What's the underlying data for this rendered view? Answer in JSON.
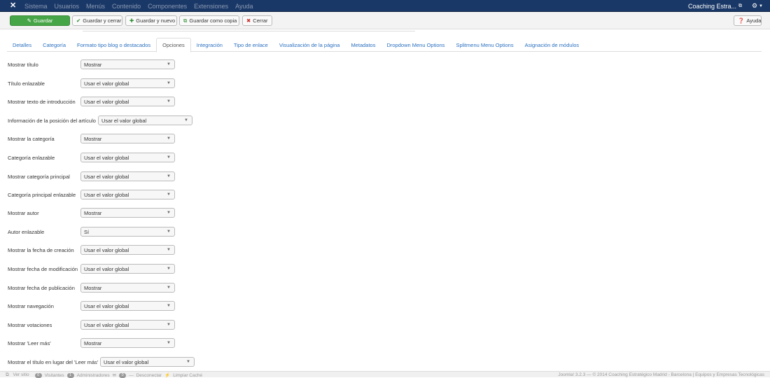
{
  "navbar": {
    "logo_icon": "joomla-logo-icon",
    "menu": [
      "Sistema",
      "Usuarios",
      "Menús",
      "Contenido",
      "Componentes",
      "Extensiones",
      "Ayuda"
    ],
    "site_name": "Coaching Estra...",
    "user_icon": "gear-icon"
  },
  "toolbar": {
    "save": "Guardar",
    "save_close": "Guardar y cerrar",
    "save_new": "Guardar y nuevo",
    "save_copy": "Guardar como copia",
    "close": "Cerrar",
    "help": "Ayuda"
  },
  "tabs": [
    "Detalles",
    "Categoría",
    "Formato tipo blog o destacados",
    "Opciones",
    "Integración",
    "Tipo de enlace",
    "Visualización de la página",
    "Metadatos",
    "Dropdown Menu Options",
    "Splitmenu Menu Options",
    "Asignación de módulos"
  ],
  "active_tab": "Opciones",
  "fields": [
    {
      "label": "Mostrar título",
      "value": "Mostrar"
    },
    {
      "label": "Título enlazable",
      "value": "Usar el valor global"
    },
    {
      "label": "Mostrar texto de introducción",
      "value": "Usar el valor global"
    },
    {
      "label": "Información de la posición del artículo",
      "value": "Usar el valor global"
    },
    {
      "label": "Mostrar la categoría",
      "value": "Mostrar"
    },
    {
      "label": "Categoría enlazable",
      "value": "Usar el valor global"
    },
    {
      "label": "Mostrar categoría principal",
      "value": "Usar el valor global"
    },
    {
      "label": "Categoría principal enlazable",
      "value": "Usar el valor global"
    },
    {
      "label": "Mostrar autor",
      "value": "Mostrar"
    },
    {
      "label": "Autor enlazable",
      "value": "Sí"
    },
    {
      "label": "Mostrar la fecha de creación",
      "value": "Usar el valor global"
    },
    {
      "label": "Mostrar fecha de modificación",
      "value": "Usar el valor global"
    },
    {
      "label": "Mostrar fecha de publicación",
      "value": "Mostrar"
    },
    {
      "label": "Mostrar navegación",
      "value": "Usar el valor global"
    },
    {
      "label": "Mostrar votaciones",
      "value": "Usar el valor global"
    },
    {
      "label": "Mostrar 'Leer más'",
      "value": "Mostrar"
    },
    {
      "label": "Mostrar el título en lugar del 'Leer más'",
      "value": "Usar el valor global"
    }
  ],
  "statusbar": {
    "view_site": "Ver sitio",
    "visitors_count": "0",
    "visitors": "Visitantes",
    "admins_count": "1",
    "admins": "Administradores",
    "messages_count": "0",
    "logout": "Desconectar",
    "clear_cache": "Limpiar Caché",
    "footer": "Joomla! 3.2.3 — © 2014 Coaching Estratégico Madrid - Barcelona | Equipos y Empresas Tecnológicas"
  }
}
